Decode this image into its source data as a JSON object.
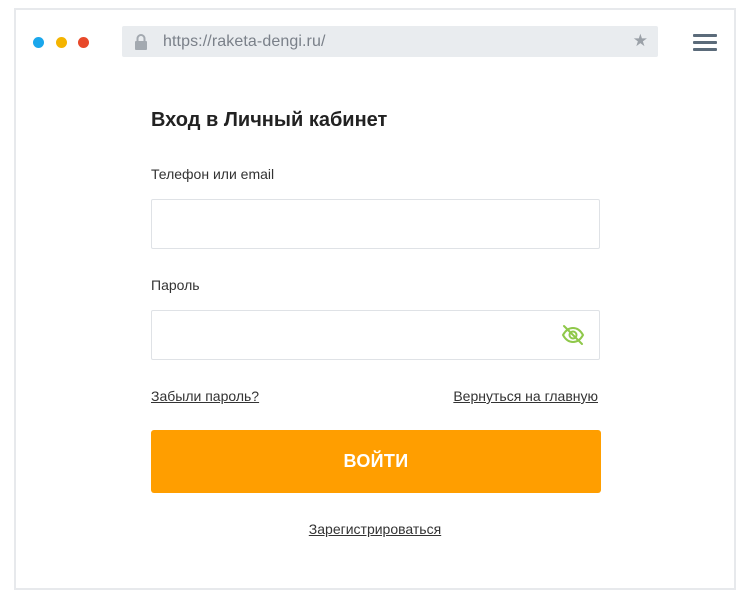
{
  "browser": {
    "url": "https://raketa-dengi.ru/",
    "traffic_lights": [
      "#1aa7ec",
      "#f4b400",
      "#e8492a"
    ],
    "icons": {
      "lock": "lock-icon",
      "bookmark": "star-icon",
      "menu": "hamburger-menu-icon"
    }
  },
  "login_form": {
    "title": "Вход в Личный кабинет",
    "phone_label": "Телефон или email",
    "phone_value": "",
    "password_label": "Пароль",
    "password_value": "",
    "password_toggle_icon": "eye-off-icon",
    "forgot_link": "Забыли пароль?",
    "home_link": "Вернуться на главную",
    "submit_label": "ВОЙТИ",
    "register_link": "Зарегистрироваться"
  },
  "colors": {
    "accent": "#ff9e00",
    "eye_icon": "#8fc84a"
  }
}
